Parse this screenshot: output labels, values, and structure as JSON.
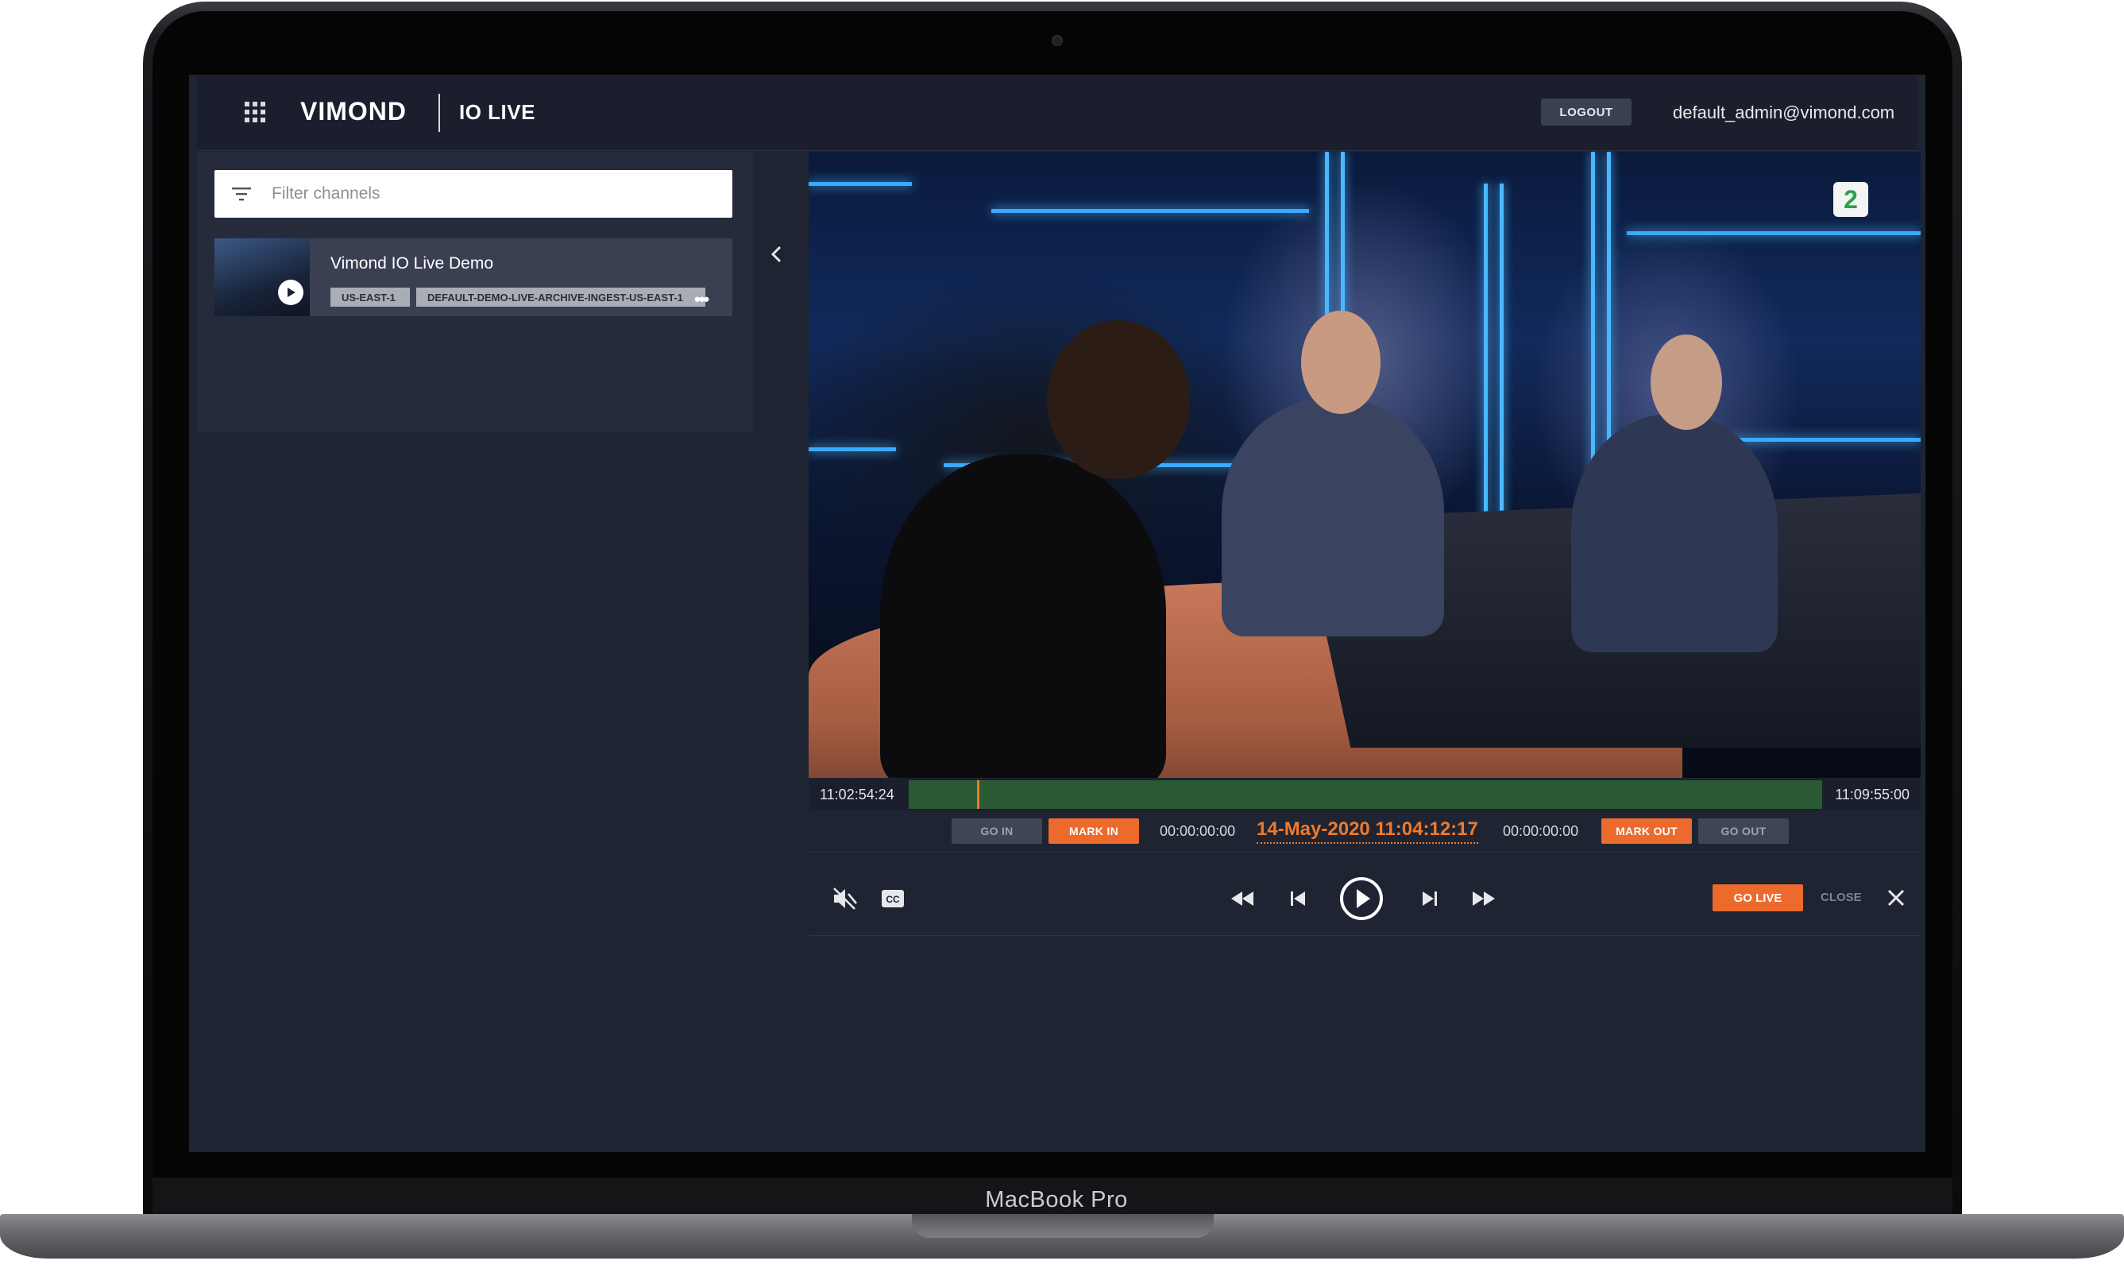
{
  "device": {
    "label": "MacBook Pro"
  },
  "header": {
    "brand": "VIMOND",
    "product": "IO LIVE",
    "logout_label": "LOGOUT",
    "user_email": "default_admin@vimond.com"
  },
  "sidebar": {
    "filter_placeholder": "Filter channels",
    "channels": [
      {
        "name": "Vimond IO Live Demo",
        "region": "US-EAST-1",
        "ingest": "DEFAULT-DEMO-LIVE-ARCHIVE-INGEST-US-EAST-1"
      }
    ]
  },
  "player": {
    "channel_logo": "2",
    "timeline": {
      "start": "11:02:54:24",
      "end": "11:09:55:00",
      "position": 0.075
    },
    "marks": {
      "go_in": "GO IN",
      "mark_in": "MARK IN",
      "in_time": "00:00:00:00",
      "current": "14-May-2020 11:04:12:17",
      "out_time": "00:00:00:00",
      "mark_out": "MARK OUT",
      "go_out": "GO OUT"
    },
    "controls": {
      "go_live": "GO LIVE",
      "close": "CLOSE"
    }
  },
  "colors": {
    "accent": "#ec6a2c",
    "background": "#1f2433",
    "timeline": "#2a5a33"
  },
  "icons": [
    "apps-grid-icon",
    "filter-icon",
    "play-icon",
    "more-icon",
    "chevron-left-icon",
    "mute-icon",
    "closed-captions-icon",
    "rewind-icon",
    "skip-back-icon",
    "play-circle-icon",
    "skip-forward-icon",
    "fast-forward-icon",
    "close-icon"
  ]
}
